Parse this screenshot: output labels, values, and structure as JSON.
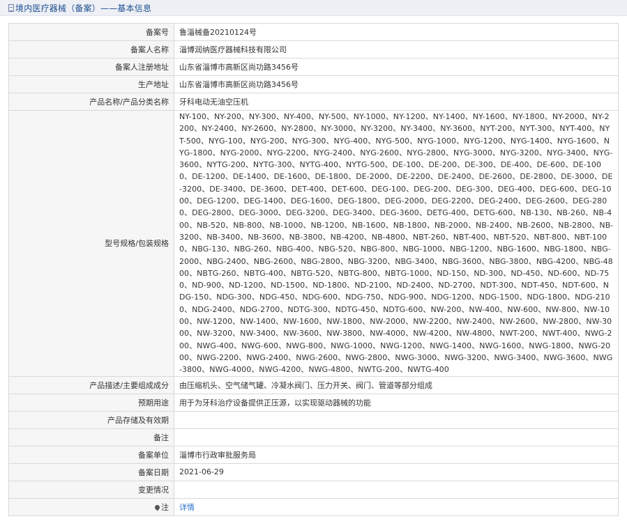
{
  "header": {
    "title": "境内医疗器械（备案）——基本信息"
  },
  "rows": [
    {
      "label": "备案号",
      "value": "鲁淄械备20210124号"
    },
    {
      "label": "备案人名称",
      "value": "淄博润纳医疗器械科技有限公司"
    },
    {
      "label": "备案人注册地址",
      "value": "山东省淄博市高新区尚功路3456号"
    },
    {
      "label": "生产地址",
      "value": "山东省淄博市高新区尚功路3456号"
    },
    {
      "label": "产品名称/产品分类名称",
      "value": "牙科电动无油空压机"
    },
    {
      "label": "型号规格/包装规格",
      "value": "NY-100、NY-200、NY-300、NY-400、NY-500、NY-1000、NY-1200、NY-1400、NY-1600、NY-1800、NY-2000、NY-2200、NY-2400、NY-2600、NY-2800、NY-3000、NY-3200、NY-3400、NY-3600、NYT-200、NYT-300、NYT-400、NYT-500、NYG-100、NYG-200、NYG-300、NYG-400、NYG-500、NYG-1000、NYG-1200、NYG-1400、NYG-1600、NYG-1800、NYG-2000、NYG-2200、NYG-2400、NYG-2600、NYG-2800、NYG-3000、NYG-3200、NYG-3400、NYG-3600、NYTG-200、NYTG-300、NYTG-400、NYTG-500、DE-100、DE-200、DE-300、DE-400、DE-600、DE-1000、DE-1200、DE-1400、DE-1600、DE-1800、DE-2000、DE-2200、DE-2400、DE-2600、DE-2800、DE-3000、DE-3200、DE-3400、DE-3600、DET-400、DET-600、DEG-100、DEG-200、DEG-300、DEG-400、DEG-600、DEG-1000、DEG-1200、DEG-1400、DEG-1600、DEG-1800、DEG-2000、DEG-2200、DEG-2400、DEG-2600、DEG-2800、DEG-2800、DEG-3000、DEG-3200、DEG-3400、DEG-3600、DETG-400、DETG-600、NB-130、NB-260、NB-400、NB-520、NB-800、NB-1000、NB-1200、NB-1600、NB-1800、NB-2000、NB-2400、NB-2600、NB-2800、NB-3200、NB-3400、NB-3600、NB-3800、NB-4200、NB-4800、NBT-260、NBT-400、NBT-520、NBT-800、NBT-1000、NBG-130、NBG-260、NBG-400、NBG-520、NBG-800、NBG-1000、NBG-1200、NBG-1600、NBG-1800、NBG-2000、NBG-2400、NBG-2600、NBG-2800、NBG-3200、NBG-3400、NBG-3600、NBG-3800、NBG-4200、NBG-4800、NBTG-260、NBTG-400、NBTG-520、NBTG-800、NBTG-1000、ND-150、ND-300、ND-450、ND-600、ND-750、ND-900、ND-1200、ND-1500、ND-1800、ND-2100、ND-2400、ND-2700、NDT-300、NDT-450、NDT-600、NDG-150、NDG-300、NDG-450、NDG-600、NDG-750、NDG-900、NDG-1200、NDG-1500、NDG-1800、NDG-2100、NDG-2400、NDG-2700、NDTG-300、NDTG-450、NDTG-600、NW-200、NW-400、NW-600、NW-800、NW-1000、NW-1200、NW-1400、NW-1600、NW-1800、NW-2000、NW-2200、NW-2400、NW-2600、NW-2800、NW-3000、NW-3200、NW-3400、NW-3600、NW-3800、NW-4000、NW-4200、NW-4800、NWT-200、NWT-400、NWG-200、NWG-400、NWG-600、NWG-800、NWG-1000、NWG-1200、NWG-1400、NWG-1600、NWG-1800、NWG-2000、NWG-2200、NWG-2400、NWG-2600、NWG-2800、NWG-3000、NWG-3200、NWG-3400、NWG-3600、NWG-3800、NWG-4000、NWG-4200、NWG-4800、NWTG-200、NWTG-400"
    },
    {
      "label": "产品描述/主要组成成分",
      "value": "由压缩机头、空气储气罐、冷凝水阀门、压力开关、阀门、管道等部分组成"
    },
    {
      "label": "预期用途",
      "value": "用于为牙科治疗设备提供正压源，以实现驱动器械的功能"
    },
    {
      "label": "产品存储及有效期",
      "value": ""
    },
    {
      "label": "备注",
      "value": ""
    },
    {
      "label": "备案单位",
      "value": "淄博市行政审批服务局"
    },
    {
      "label": "备案日期",
      "value": "2021-06-29"
    },
    {
      "label": "变更情况",
      "value": ""
    },
    {
      "label": "注",
      "value": "详情",
      "icon": "map-pin-icon"
    }
  ]
}
